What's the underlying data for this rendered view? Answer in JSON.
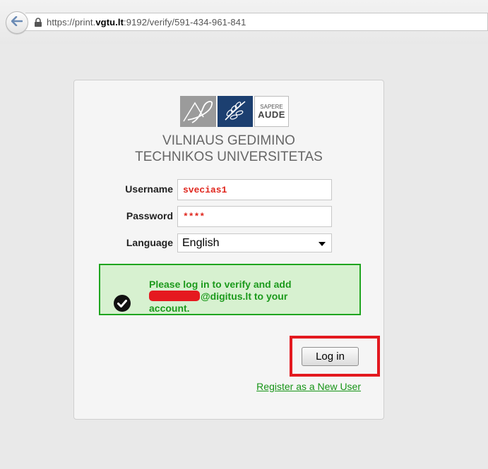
{
  "browser": {
    "url_prefix": "https://print.",
    "url_domain": "vgtu.lt",
    "url_suffix": ":9192/verify/591-434-961-841",
    "back_icon": "back-arrow-icon",
    "lock_icon": "lock-icon"
  },
  "logo": {
    "motto_line1": "SAPERE",
    "motto_line2": "AUDE",
    "university_line1": "VILNIAUS GEDIMINO",
    "university_line2": "TECHNIKOS UNIVERSITETAS"
  },
  "form": {
    "username_label": "Username",
    "username_value": "svecias1",
    "password_label": "Password",
    "password_value": "****",
    "language_label": "Language",
    "language_value": "English"
  },
  "message": {
    "line1": "Please log in to verify and add",
    "line2_suffix": "@digitus.lt to your",
    "line3": "account.",
    "icon": "check-circle-icon",
    "colors": {
      "text": "#1c9a1c",
      "border": "#1fa51f",
      "background": "#d7f1d0"
    }
  },
  "actions": {
    "login_label": "Log in",
    "register_label": "Register as a New User"
  },
  "colors": {
    "highlight": "#e3191f",
    "link": "#169416"
  }
}
